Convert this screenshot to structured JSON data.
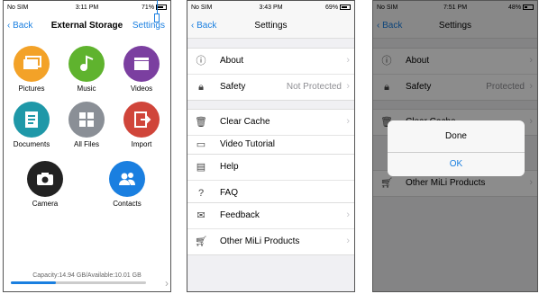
{
  "panel1": {
    "status": {
      "carrier": "No SIM",
      "time": "3:11 PM",
      "battery": "71%"
    },
    "nav": {
      "back": "Back",
      "title": "External Storage",
      "right": "Settings"
    },
    "tiles": [
      {
        "label": "Pictures",
        "icon": "pictures-icon",
        "color": "#f3a228"
      },
      {
        "label": "Music",
        "icon": "music-icon",
        "color": "#5fb32e"
      },
      {
        "label": "Videos",
        "icon": "videos-icon",
        "color": "#7b3fa0"
      },
      {
        "label": "Documents",
        "icon": "documents-icon",
        "color": "#1f98a8"
      },
      {
        "label": "All Files",
        "icon": "all-files-icon",
        "color": "#8a8f96"
      },
      {
        "label": "Import",
        "icon": "import-icon",
        "color": "#d0453a"
      },
      {
        "label": "Camera",
        "icon": "camera-icon",
        "color": "#222222"
      },
      {
        "label": "Contacts",
        "icon": "contacts-icon",
        "color": "#1a7fe0"
      }
    ],
    "storage": {
      "text": "Capacity:14.94 GB/Available:10.01 GB",
      "used_fraction": 0.33
    }
  },
  "panel2": {
    "status": {
      "carrier": "No SIM",
      "time": "3:43 PM",
      "battery": "69%"
    },
    "nav": {
      "back": "Back",
      "title": "Settings"
    },
    "rows": [
      {
        "label": "About",
        "value": "",
        "icon": "info-icon"
      },
      {
        "label": "Safety",
        "value": "Not Protected",
        "icon": "lock-icon"
      },
      {
        "label": "Clear Cache",
        "value": "",
        "icon": "trash-icon"
      },
      {
        "label": "Video Tutorial",
        "value": "",
        "icon": "video-icon"
      },
      {
        "label": "Help",
        "value": "",
        "icon": "document-icon"
      },
      {
        "label": "FAQ",
        "value": "",
        "icon": "question-icon"
      },
      {
        "label": "Feedback",
        "value": "",
        "icon": "feedback-icon"
      },
      {
        "label": "Other MiLi Products",
        "value": "",
        "icon": "cart-icon"
      }
    ]
  },
  "panel3": {
    "status": {
      "carrier": "No SIM",
      "time": "7:51 PM",
      "battery": "48%"
    },
    "nav": {
      "back": "Back",
      "title": "Settings"
    },
    "rows": [
      {
        "label": "About",
        "value": ""
      },
      {
        "label": "Safety",
        "value": "Protected"
      },
      {
        "label": "Clear Cache",
        "value": ""
      },
      {
        "label": "Other MiLi Products",
        "value": ""
      }
    ],
    "alert": {
      "title": "Done",
      "button": "OK"
    }
  }
}
